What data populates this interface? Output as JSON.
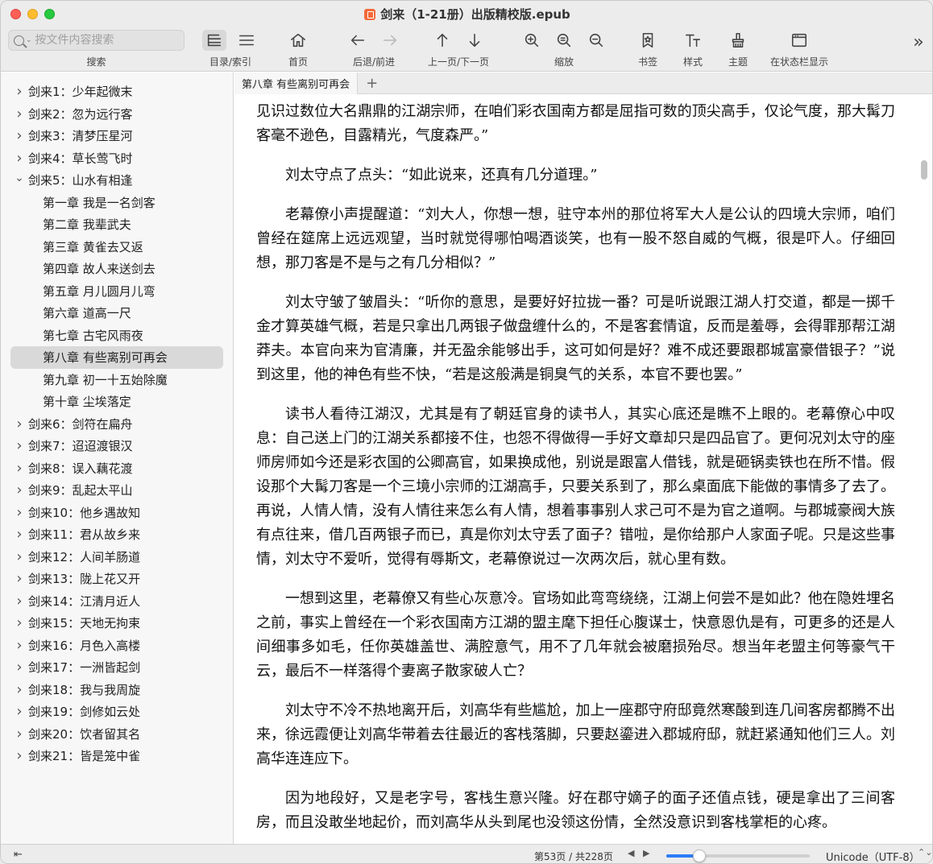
{
  "window": {
    "title": "剑来（1-21册）出版精校版.epub"
  },
  "toolbar": {
    "search_placeholder": "按文件内容搜索",
    "search_label": "搜索",
    "toc_label": "目录/索引",
    "home_label": "首页",
    "backforward_label": "后退/前进",
    "prevnext_label": "上一页/下一页",
    "zoom_label": "缩放",
    "bookmark_label": "书签",
    "style_label": "样式",
    "theme_label": "主题",
    "statusbar_label": "在状态栏显示",
    "overflow_glyph": "»"
  },
  "sidebar": {
    "items": [
      {
        "label": "剑来1：少年起微末",
        "level": 0,
        "expanded": false
      },
      {
        "label": "剑来2：忽为远行客",
        "level": 0,
        "expanded": false
      },
      {
        "label": "剑来3：清梦压星河",
        "level": 0,
        "expanded": false
      },
      {
        "label": "剑来4：草长莺飞时",
        "level": 0,
        "expanded": false
      },
      {
        "label": "剑来5：山水有相逢",
        "level": 0,
        "expanded": true
      },
      {
        "label": "第一章 我是一名剑客",
        "level": 1
      },
      {
        "label": "第二章 我辈武夫",
        "level": 1
      },
      {
        "label": "第三章 黄雀去又返",
        "level": 1
      },
      {
        "label": "第四章 故人来送剑去",
        "level": 1
      },
      {
        "label": "第五章 月儿圆月儿弯",
        "level": 1
      },
      {
        "label": "第六章 道高一尺",
        "level": 1
      },
      {
        "label": "第七章 古宅风雨夜",
        "level": 1
      },
      {
        "label": "第八章 有些离别可再会",
        "level": 1,
        "selected": true
      },
      {
        "label": "第九章 初一十五始除魔",
        "level": 1
      },
      {
        "label": "第十章 尘埃落定",
        "level": 1
      },
      {
        "label": "剑来6：剑符在扁舟",
        "level": 0,
        "expanded": false
      },
      {
        "label": "剑来7：迢迢渡银汉",
        "level": 0,
        "expanded": false
      },
      {
        "label": "剑来8：误入藕花渡",
        "level": 0,
        "expanded": false
      },
      {
        "label": "剑来9：乱起太平山",
        "level": 0,
        "expanded": false
      },
      {
        "label": "剑来10：他乡遇故知",
        "level": 0,
        "expanded": false
      },
      {
        "label": "剑来11：君从故乡来",
        "level": 0,
        "expanded": false
      },
      {
        "label": "剑来12：人间羊肠道",
        "level": 0,
        "expanded": false
      },
      {
        "label": "剑来13：陇上花又开",
        "level": 0,
        "expanded": false
      },
      {
        "label": "剑来14：江清月近人",
        "level": 0,
        "expanded": false
      },
      {
        "label": "剑来15：天地无拘束",
        "level": 0,
        "expanded": false
      },
      {
        "label": "剑来16：月色入高楼",
        "level": 0,
        "expanded": false
      },
      {
        "label": "剑来17：一洲皆起剑",
        "level": 0,
        "expanded": false
      },
      {
        "label": "剑来18：我与我周旋",
        "level": 0,
        "expanded": false
      },
      {
        "label": "剑来19：剑修如云处",
        "level": 0,
        "expanded": false
      },
      {
        "label": "剑来20：饮者留其名",
        "level": 0,
        "expanded": false
      },
      {
        "label": "剑来21：皆是笼中雀",
        "level": 0,
        "expanded": false
      }
    ]
  },
  "tabs": {
    "active": "第八章 有些离别可再会",
    "add_glyph": "+"
  },
  "content": {
    "paragraphs": [
      "见识过数位大名鼎鼎的江湖宗师，在咱们彩衣国南方都是屈指可数的顶尖高手，仅论气度，那大髯刀客毫不逊色，目露精光，气度森严。”",
      "刘太守点了点头：“如此说来，还真有几分道理。”",
      "老幕僚小声提醒道：“刘大人，你想一想，驻守本州的那位将军大人是公认的四境大宗师，咱们曾经在筵席上远远观望，当时就觉得哪怕喝酒谈笑，也有一股不怒自威的气概，很是吓人。仔细回想，那刀客是不是与之有几分相似？”",
      "刘太守皱了皱眉头：“听你的意思，是要好好拉拢一番？可是听说跟江湖人打交道，都是一掷千金才算英雄气概，若是只拿出几两银子做盘缠什么的，不是客套情谊，反而是羞辱，会得罪那帮江湖莽夫。本官向来为官清廉，并无盈余能够出手，这可如何是好？难不成还要跟郡城富豪借银子？”说到这里，他的神色有些不快，“若是这般满是铜臭气的关系，本官不要也罢。”",
      "读书人看待江湖汉，尤其是有了朝廷官身的读书人，其实心底还是瞧不上眼的。老幕僚心中叹息：自己送上门的江湖关系都接不住，也怨不得做得一手好文章却只是四品官了。更何况刘太守的座师房师如今还是彩衣国的公卿高官，如果换成他，别说是跟富人借钱，就是砸锅卖铁也在所不惜。假设那个大髯刀客是一个三境小宗师的江湖高手，只要关系到了，那么桌面底下能做的事情多了去了。再说，人情人情，没有人情往来怎么有人情，想着事事别人求己可不是为官之道啊。与郡城豪阀大族有点往来，借几百两银子而已，真是你刘太守丢了面子？错啦，是你给那户人家面子呢。只是这些事情，刘太守不爱听，觉得有辱斯文，老幕僚说过一次两次后，就心里有数。",
      "一想到这里，老幕僚又有些心灰意冷。官场如此弯弯绕绕，江湖上何尝不是如此？他在隐姓埋名之前，事实上曾经在一个彩衣国南方江湖的盟主麾下担任心腹谋士，快意恩仇是有，可更多的还是人间细事多如毛，任你英雄盖世、满腔意气，用不了几年就会被磨损殆尽。想当年老盟主何等豪气干云，最后不一样落得个妻离子散家破人亡？",
      "刘太守不冷不热地离开后，刘高华有些尴尬，加上一座郡守府邸竟然寒酸到连几间客房都腾不出来，徐远霞便让刘高华带着去往最近的客栈落脚，只要赵鎏进入郡城府邸，就赶紧通知他们三人。刘高华连连应下。",
      "因为地段好，又是老字号，客栈生意兴隆。好在郡守嫡子的面子还值点钱，硬是拿出了三间客房，而且没敢坐地起价，而刘高华从头到尾也没领这份情，全然没意识到客栈掌柜的心疼。"
    ]
  },
  "statusbar": {
    "toggle_glyph": "⇤",
    "page_text": "第53页 / 共228页",
    "prev_glyph": "◀",
    "next_glyph": "▶",
    "progress": 0.232,
    "encoding": "Unicode（UTF-8）",
    "encoding_chevron": "⌃⌄"
  },
  "colors": {
    "accent": "#2d7cf6",
    "selection": "#d9d9d9",
    "close": "#fe5f57",
    "minimize": "#febc2e",
    "maximize": "#28c840"
  }
}
